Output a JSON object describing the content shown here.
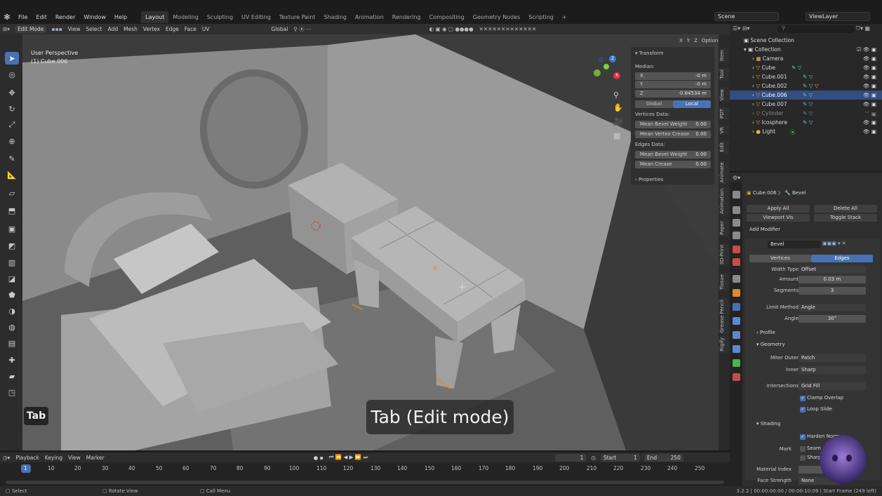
{
  "menu": [
    "File",
    "Edit",
    "Render",
    "Window",
    "Help"
  ],
  "workspaces": [
    "Layout",
    "Modeling",
    "Sculpting",
    "UV Editing",
    "Texture Paint",
    "Shading",
    "Animation",
    "Rendering",
    "Compositing",
    "Geometry Nodes",
    "Scripting"
  ],
  "add_workspace": "+",
  "scene_name": "Scene",
  "view_layer": "ViewLayer",
  "header": {
    "mode": "Edit Mode",
    "items": [
      "View",
      "Select",
      "Add",
      "Mesh",
      "Vertex",
      "Edge",
      "Face",
      "UV"
    ],
    "orientation": "Global",
    "options": "Options",
    "xyz": [
      "X",
      "Y",
      "Z"
    ]
  },
  "viewport": {
    "perspective": "User Perspective",
    "object": "(1) Cube.006"
  },
  "npanel": {
    "transform": "Transform",
    "median": "Median:",
    "x_label": "X",
    "x_value": "-0 m",
    "y_label": "Y",
    "y_value": "-0 m",
    "z_label": "Z",
    "z_value": "-0.84534 m",
    "global": "Global",
    "local": "Local",
    "vertices_data": "Vertices Data:",
    "mean_bevel_weight": "Mean Bevel Weight",
    "mean_bevel_weight_v": "0.00",
    "mean_vertex_crease": "Mean Vertex Crease",
    "mean_vertex_crease_v": "0.00",
    "edges_data": "Edges Data:",
    "mean_bevel_weight_e": "Mean Bevel Weight",
    "mean_bevel_weight_e_v": "0.00",
    "mean_crease": "Mean Crease",
    "mean_crease_v": "0.00",
    "properties": "Properties"
  },
  "side_tabs": [
    "Item",
    "Tool",
    "View",
    "PDT",
    "VR",
    "Edit",
    "Animate",
    "Animation",
    "Paper",
    "3D-Print",
    "Tissue",
    "Grease Pencil",
    "Rigify"
  ],
  "outliner": {
    "scene_collection": "Scene Collection",
    "collection": "Collection",
    "items": [
      "Camera",
      "Cube",
      "Cube.001",
      "Cube.002",
      "Cube.006",
      "Cube.007",
      "Cylinder",
      "Icosphere",
      "Light"
    ]
  },
  "properties": {
    "object": "Cube.006",
    "modifier": "Bevel",
    "apply_all": "Apply All",
    "delete_all": "Delete All",
    "viewport_vis": "Viewport Vis",
    "toggle_stack": "Toggle Stack",
    "add_modifier": "Add Modifier",
    "mod_name": "Bevel",
    "vertices": "Vertices",
    "edges": "Edges",
    "width_type_label": "Width Type",
    "width_type": "Offset",
    "amount_label": "Amount",
    "amount": "0.03 m",
    "segments_label": "Segments",
    "segments": "3",
    "limit_method_label": "Limit Method",
    "limit_method": "Angle",
    "angle_label": "Angle",
    "angle": "30°",
    "profile": "Profile",
    "geometry": "Geometry",
    "miter_outer_label": "Miter Outer",
    "miter_outer": "Patch",
    "inner_label": "Inner",
    "inner": "Sharp",
    "intersections_label": "Intersections",
    "intersections": "Grid Fill",
    "clamp_overlap": "Clamp Overlap",
    "loop_slide": "Loop Slide",
    "shading": "Shading",
    "harden_normals": "Harden Norm",
    "mark_label": "Mark",
    "seam": "Seam",
    "sharp": "Sharp",
    "material_index_label": "Material Index",
    "face_strength_label": "Face Strength",
    "face_strength": "None"
  },
  "timeline": {
    "items": [
      "Playback",
      "Keying",
      "View",
      "Marker"
    ],
    "current_frame": "1",
    "start_label": "Start",
    "start": "1",
    "end_label": "End",
    "end": "250",
    "ticks": [
      "1",
      "10",
      "20",
      "30",
      "40",
      "50",
      "60",
      "70",
      "80",
      "90",
      "100",
      "110",
      "120",
      "130",
      "140",
      "150",
      "160",
      "170",
      "180",
      "190",
      "200",
      "210",
      "220",
      "230",
      "240",
      "250"
    ]
  },
  "status": {
    "select": "Select",
    "rotate": "Rotate View",
    "call_menu": "Call Menu",
    "info": "3.2.2 | 00:00:00:00 / 00:00:10:09 | Start Frame (249 left)"
  },
  "overlay": {
    "caption": "Tab (Edit mode)",
    "key": "Tab"
  },
  "colors": {
    "accent": "#4772b3",
    "selected_row": "#334d80",
    "viewport_bg": "#3c3c3c"
  }
}
